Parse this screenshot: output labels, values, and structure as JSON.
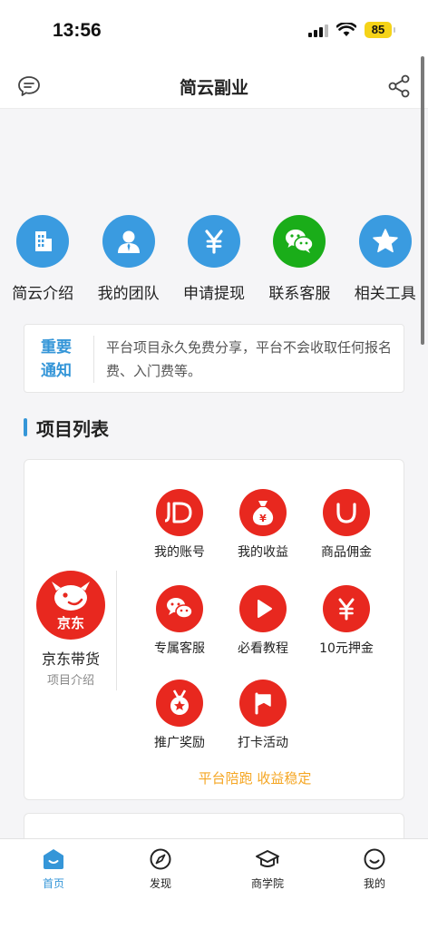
{
  "status": {
    "time": "13:56",
    "battery": "85"
  },
  "header": {
    "title": "简云副业"
  },
  "quick_actions": [
    {
      "label": "简云介绍",
      "icon": "building-icon",
      "color": "#3a9be0"
    },
    {
      "label": "我的团队",
      "icon": "user-icon",
      "color": "#3a9be0"
    },
    {
      "label": "申请提现",
      "icon": "yen-icon",
      "color": "#3a9be0"
    },
    {
      "label": "联系客服",
      "icon": "wechat-icon",
      "color": "#1aad19"
    },
    {
      "label": "相关工具",
      "icon": "star-icon",
      "color": "#3a9be0"
    }
  ],
  "notice": {
    "tag": "重要通知",
    "text": "平台项目永久免费分享，平台不会收取任何报名费、入门费等。"
  },
  "section": {
    "title": "项目列表"
  },
  "project": {
    "logo_text": "京东",
    "name": "京东带货",
    "subtitle": "项目介绍",
    "accent": "#e8281f",
    "items": [
      {
        "label": "我的账号",
        "icon": "jd-icon"
      },
      {
        "label": "我的收益",
        "icon": "money-bag-icon"
      },
      {
        "label": "商品佣金",
        "icon": "smile-icon"
      },
      {
        "label": "专属客服",
        "icon": "chat-icon"
      },
      {
        "label": "必看教程",
        "icon": "play-icon"
      },
      {
        "label": "10元押金",
        "icon": "yen-icon"
      },
      {
        "label": "推广奖励",
        "icon": "medal-icon"
      },
      {
        "label": "打卡活动",
        "icon": "flag-icon"
      }
    ],
    "slogan": "平台陪跑 收益稳定"
  },
  "tabs": [
    {
      "label": "首页",
      "icon": "home-icon",
      "active": true
    },
    {
      "label": "发现",
      "icon": "compass-icon",
      "active": false
    },
    {
      "label": "商学院",
      "icon": "graduation-cap-icon",
      "active": false
    },
    {
      "label": "我的",
      "icon": "profile-icon",
      "active": false
    }
  ],
  "colors": {
    "accent_blue": "#3596d8",
    "jd_red": "#e8281f",
    "slogan_orange": "#f5a623"
  }
}
